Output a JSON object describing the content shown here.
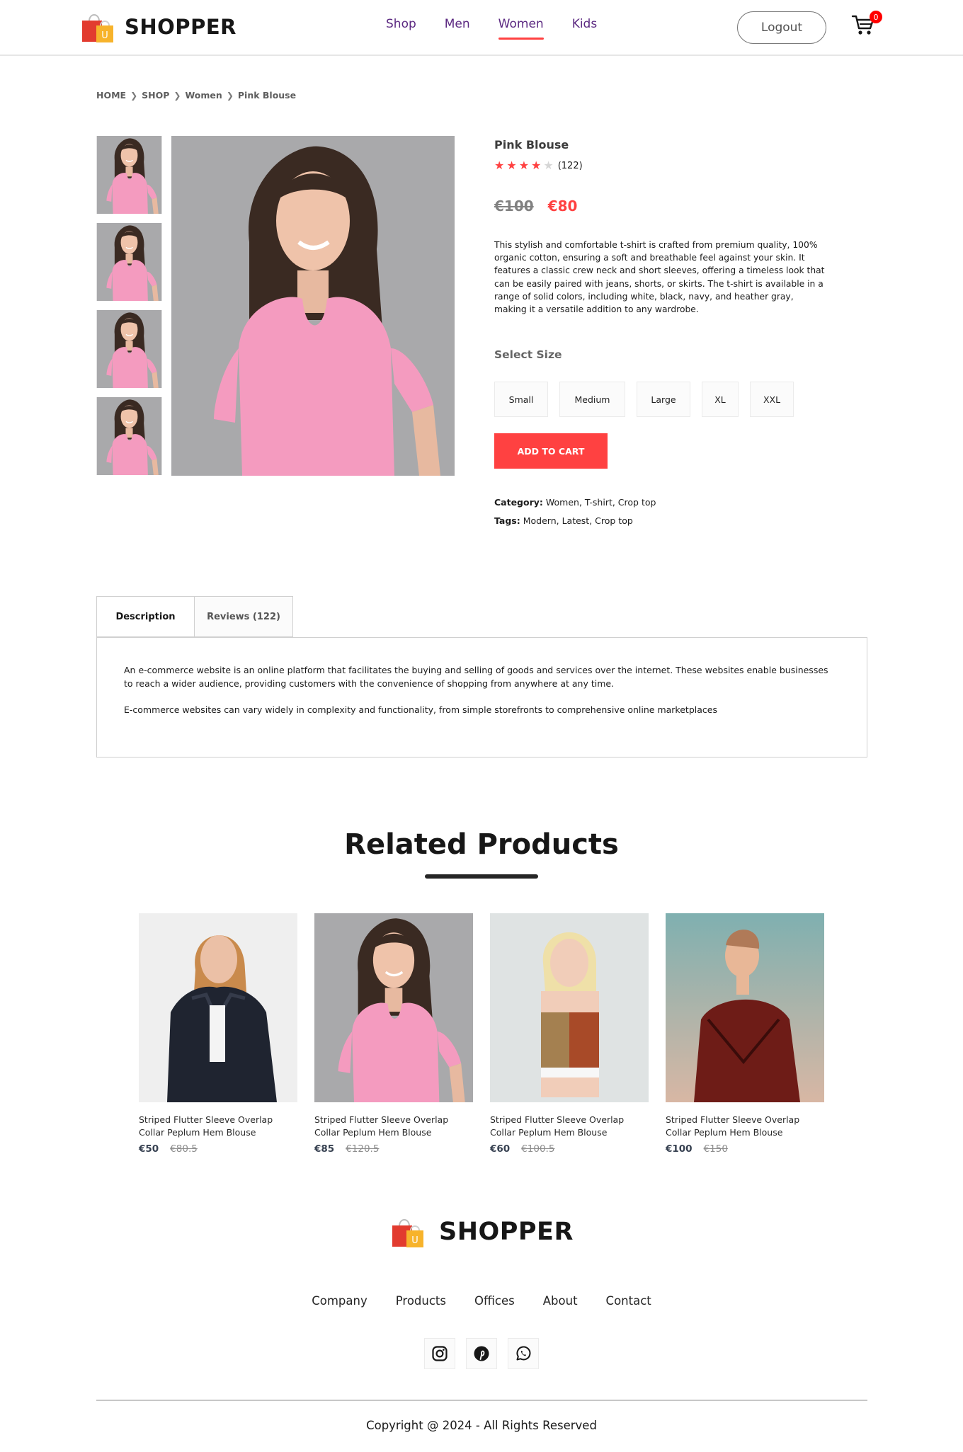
{
  "brand": {
    "name": "SHOPPER"
  },
  "nav": {
    "items": [
      {
        "label": "Shop"
      },
      {
        "label": "Men"
      },
      {
        "label": "Women"
      },
      {
        "label": "Kids"
      }
    ],
    "active_item": "Women",
    "logout_label": "Logout",
    "cart_count": "0"
  },
  "breadcrumb": [
    "HOME",
    "SHOP",
    "Women",
    "Pink Blouse"
  ],
  "product": {
    "title": "Pink Blouse",
    "rating": 4,
    "rating_count": "(122)",
    "old_price": "€100",
    "new_price": "€80",
    "description": "This stylish and comfortable t-shirt is crafted from premium quality, 100% organic cotton, ensuring a soft and breathable feel against your skin. It features a classic crew neck and short sleeves, offering a timeless look that can be easily paired with jeans, shorts, or skirts. The t-shirt is available in a range of solid colors, including white, black, navy, and heather gray, making it a versatile addition to any wardrobe.",
    "select_size_label": "Select Size",
    "sizes": [
      "Small",
      "Medium",
      "Large",
      "XL",
      "XXL"
    ],
    "add_to_cart_label": "ADD TO CART",
    "category_label": "Category:",
    "category_value": " Women, T-shirt, Crop top",
    "tags_label": "Tags:",
    "tags_value": " Modern, Latest, Crop top"
  },
  "tabs": {
    "description_label": "Description",
    "reviews_label": "Reviews (122)",
    "paragraph1": "An e-commerce website is an online platform that facilitates the buying and selling of goods and services over the internet. These websites enable businesses to reach a wider audience, providing customers with the convenience of shopping from anywhere at any time.",
    "paragraph2": "E-commerce websites can vary widely in complexity and functionality, from simple storefronts to comprehensive online marketplaces"
  },
  "related": {
    "title": "Related Products",
    "products": [
      {
        "name": "Striped Flutter Sleeve Overlap Collar Peplum Hem Blouse",
        "new_price": "€50",
        "old_price": "€80.5"
      },
      {
        "name": "Striped Flutter Sleeve Overlap Collar Peplum Hem Blouse",
        "new_price": "€85",
        "old_price": "€120.5"
      },
      {
        "name": "Striped Flutter Sleeve Overlap Collar Peplum Hem Blouse",
        "new_price": "€60",
        "old_price": "€100.5"
      },
      {
        "name": "Striped Flutter Sleeve Overlap Collar Peplum Hem Blouse",
        "new_price": "€100",
        "old_price": "€150"
      }
    ]
  },
  "footer": {
    "links": [
      "Company",
      "Products",
      "Offices",
      "About",
      "Contact"
    ],
    "socials": [
      "instagram-icon",
      "pinterest-icon",
      "whatsapp-icon"
    ],
    "copyright": "Copyright @ 2024 - All Rights Reserved"
  },
  "colors": {
    "accent": "#ff4141",
    "nav_text": "#5c2a82",
    "dark": "#171717"
  }
}
